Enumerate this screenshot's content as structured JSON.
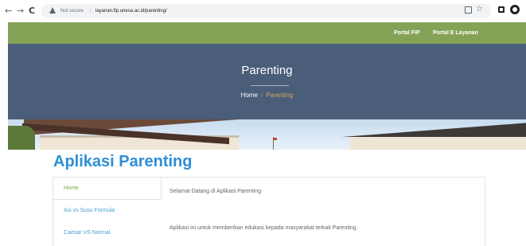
{
  "browser": {
    "back_icon": "←",
    "forward_icon": "→",
    "reload_icon": "C",
    "security_label": "Not secure",
    "url": "layanan.fip.unesa.ac.id/parenting/",
    "star_icon": "☆"
  },
  "topnav": {
    "links": [
      {
        "label": "Portal FIP"
      },
      {
        "label": "Portal E Layanan"
      }
    ]
  },
  "hero": {
    "title": "Parenting",
    "breadcrumb": {
      "home": "Home",
      "separator": "/",
      "current": "Parenting"
    }
  },
  "app": {
    "title": "Aplikasi Parenting",
    "menu": [
      {
        "label": "Home",
        "active": true
      },
      {
        "label": "Asi vs Susu Formula",
        "active": false
      },
      {
        "label": "Caesar VS Normal",
        "active": false
      }
    ],
    "welcome": "Selamat Datang di Aplikasi Parenting",
    "description": "Aplikasi ini untuk memberikan edukasi kepada masyarakat terkait Parenting"
  },
  "colors": {
    "topbar": "#85a356",
    "hero": "#4a5d79",
    "title_blue": "#2d8fd6",
    "menu_active": "#7aa846",
    "menu_link": "#4a9fd8",
    "breadcrumb_current": "#d2a95a"
  }
}
